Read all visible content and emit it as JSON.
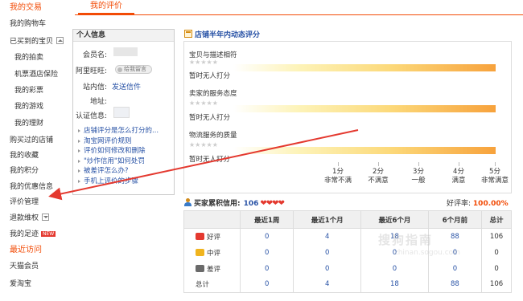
{
  "sidebar": {
    "trade_heading": "我的交易",
    "items": [
      {
        "label": "我的购物车",
        "level": "main"
      },
      {
        "label": "已买到的宝贝",
        "level": "main",
        "toggle": "up"
      },
      {
        "label": "我的拍卖",
        "level": "sub"
      },
      {
        "label": "机票酒店保险",
        "level": "sub"
      },
      {
        "label": "我的彩票",
        "level": "sub"
      },
      {
        "label": "我的游戏",
        "level": "sub"
      },
      {
        "label": "我的理财",
        "level": "sub"
      },
      {
        "label": "购买过的店铺",
        "level": "main"
      },
      {
        "label": "我的收藏",
        "level": "main"
      },
      {
        "label": "我的积分",
        "level": "main"
      },
      {
        "label": "我的优惠信息",
        "level": "main"
      },
      {
        "label": "评价管理",
        "level": "main"
      },
      {
        "label": "退款维权",
        "level": "main",
        "toggle": "down"
      },
      {
        "label": "我的足迹",
        "level": "main",
        "badge": "NEW"
      }
    ],
    "recent_heading": "最近访问",
    "recent_items": [
      "天猫会员",
      "爱淘宝"
    ]
  },
  "tab": {
    "label": "我的评价"
  },
  "info": {
    "heading": "个人信息",
    "member_label": "会员名:",
    "wangwang_label": "阿里旺旺:",
    "wangwang_btn": "给我留言",
    "inbox_label": "站内信:",
    "inbox_link": "发送信件",
    "address_label": "地址:",
    "cert_label": "认证信息:",
    "links": [
      "店铺评分是怎么打分的...",
      "淘宝网评价规则",
      "评价如何修改和删除",
      "\"炒作信用\"如何处罚",
      "被差评怎么办?",
      "手机上评价的步骤"
    ]
  },
  "ratings": {
    "heading": "店铺半年内动态评分",
    "items": [
      {
        "title": "宝贝与描述相符",
        "status": "暂时无人打分"
      },
      {
        "title": "卖家的服务态度",
        "status": "暂时无人打分"
      },
      {
        "title": "物流服务的质量",
        "status": "暂时无人打分"
      }
    ],
    "stars": "★★★★★",
    "scale": [
      {
        "score": "1分",
        "desc": "非常不满"
      },
      {
        "score": "2分",
        "desc": "不满意"
      },
      {
        "score": "3分",
        "desc": "一般"
      },
      {
        "score": "4分",
        "desc": "满意"
      },
      {
        "score": "5分",
        "desc": "非常满意"
      }
    ]
  },
  "credit": {
    "label": "买家累积信用:",
    "score": "106",
    "hearts": "❤❤❤❤",
    "good_rate_label": "好评率:",
    "good_rate_value": "100.00%"
  },
  "stats": {
    "columns": [
      "",
      "最近1周",
      "最近1个月",
      "最近6个月",
      "6个月前",
      "总计"
    ],
    "rows": [
      {
        "label": "好评",
        "icon_color": "#e4392f",
        "values": [
          "0",
          "4",
          "18",
          "88",
          "106"
        ]
      },
      {
        "label": "中评",
        "icon_color": "#f0b41e",
        "values": [
          "0",
          "0",
          "0",
          "0",
          "0"
        ]
      },
      {
        "label": "差评",
        "icon_color": "#6a6a6a",
        "values": [
          "0",
          "0",
          "0",
          "0",
          "0"
        ]
      },
      {
        "label": "总计",
        "icon_color": "",
        "values": [
          "0",
          "4",
          "18",
          "88",
          "106"
        ]
      }
    ]
  },
  "watermark": {
    "text": "搜狗指南",
    "sub": "zhinan.sogou.com"
  },
  "colors": {
    "accent": "#f24b06",
    "link": "#2953a6",
    "arrow": "#e4392f"
  }
}
